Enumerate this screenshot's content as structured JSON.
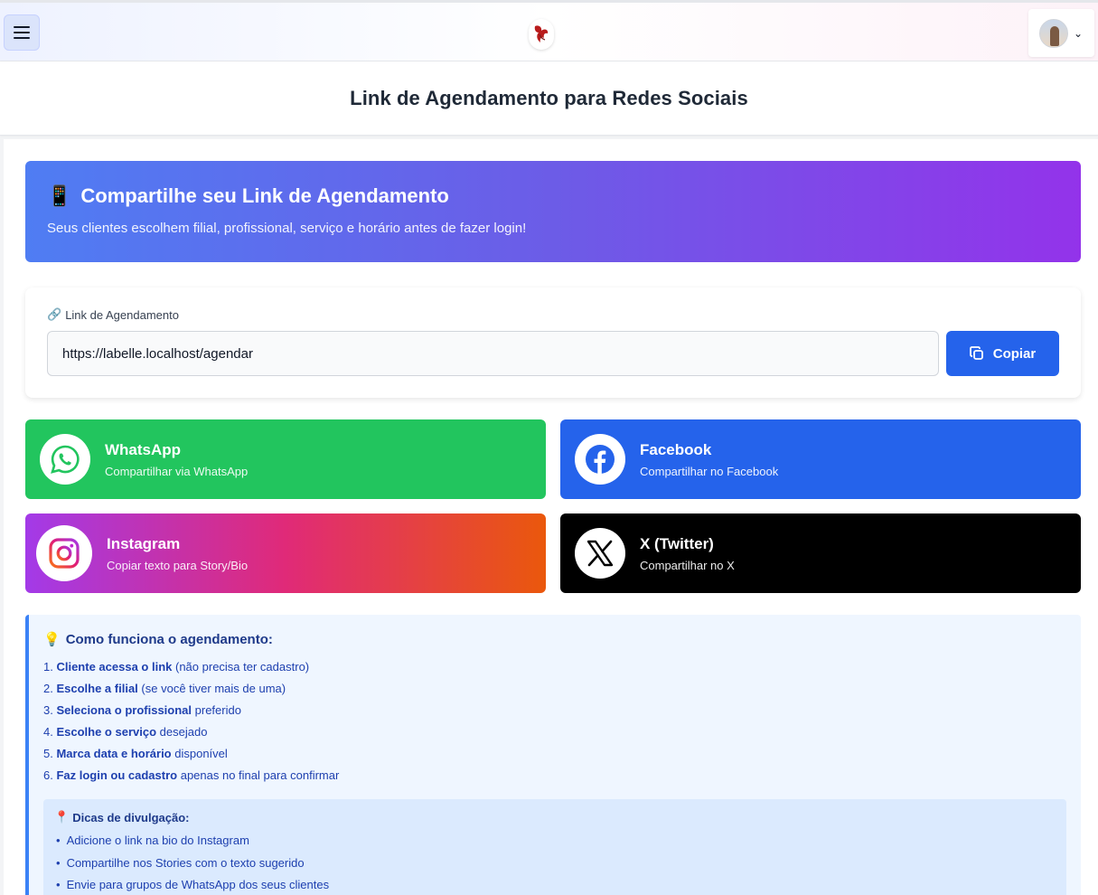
{
  "header": {
    "page_title": "Link de Agendamento para Redes Sociais"
  },
  "hero": {
    "icon": "📱",
    "title": "Compartilhe seu Link de Agendamento",
    "subtitle": "Seus clientes escolhem filial, profissional, serviço e horário antes de fazer login!"
  },
  "link": {
    "icon": "🔗",
    "label": "Link de Agendamento",
    "value": "https://labelle.localhost/agendar",
    "copy_label": "Copiar"
  },
  "social": {
    "whatsapp": {
      "name": "WhatsApp",
      "desc": "Compartilhar via WhatsApp"
    },
    "facebook": {
      "name": "Facebook",
      "desc": "Compartilhar no Facebook"
    },
    "instagram": {
      "name": "Instagram",
      "desc": "Copiar texto para Story/Bio"
    },
    "twitter": {
      "name": "X (Twitter)",
      "desc": "Compartilhar no X"
    }
  },
  "info": {
    "icon": "💡",
    "title": "Como funciona o agendamento:",
    "steps": [
      {
        "num": "1.",
        "bold": "Cliente acessa o link",
        "rest": "(não precisa ter cadastro)"
      },
      {
        "num": "2.",
        "bold": "Escolhe a filial",
        "rest": "(se você tiver mais de uma)"
      },
      {
        "num": "3.",
        "bold": "Seleciona o profissional",
        "rest": "preferido"
      },
      {
        "num": "4.",
        "bold": "Escolhe o serviço",
        "rest": "desejado"
      },
      {
        "num": "5.",
        "bold": "Marca data e horário",
        "rest": "disponível"
      },
      {
        "num": "6.",
        "bold": "Faz login ou cadastro",
        "rest": "apenas no final para confirmar"
      }
    ],
    "tips": {
      "icon": "📍",
      "title": "Dicas de divulgação:",
      "items": [
        "Adicione o link na bio do Instagram",
        "Compartilhe nos Stories com o texto sugerido",
        "Envie para grupos de WhatsApp dos seus clientes"
      ]
    }
  },
  "colors": {
    "whatsapp": "#22c55e",
    "facebook": "#2563eb",
    "twitter": "#000000",
    "copy_button": "#2563eb"
  }
}
